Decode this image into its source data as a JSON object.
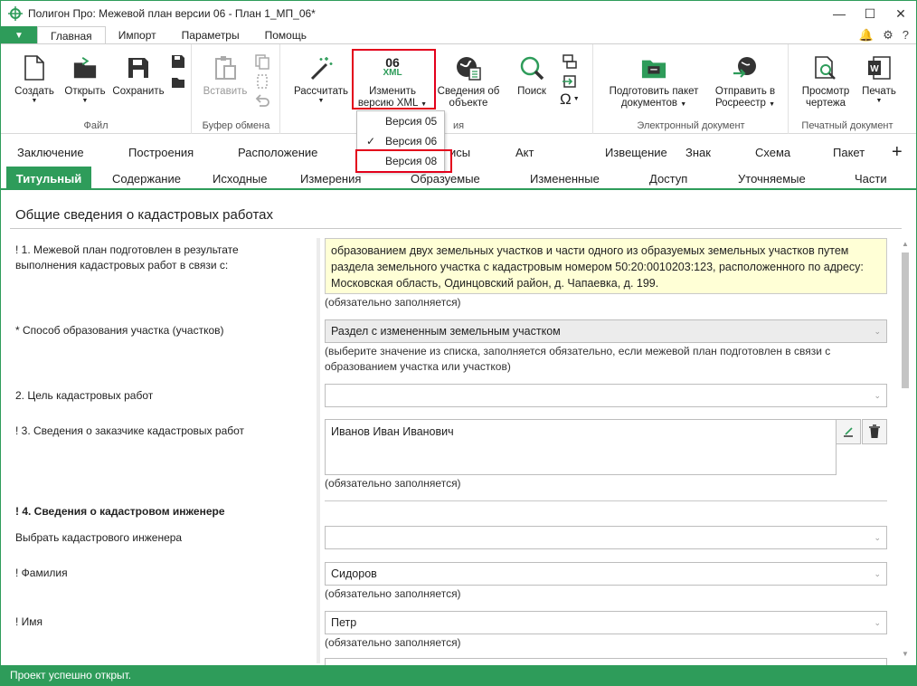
{
  "window": {
    "title": "Полигон Про: Межевой план версии 06 - План 1_МП_06*"
  },
  "menu": {
    "tabs": [
      "Главная",
      "Импорт",
      "Параметры",
      "Помощь"
    ]
  },
  "ribbon": {
    "groups": {
      "file": "Файл",
      "clipboard": "Буфер обмена",
      "edoc": "Электронный документ",
      "print": "Печатный документ",
      "hidden_partial": "ия"
    },
    "buttons": {
      "create": "Создать",
      "open": "Открыть",
      "save": "Сохранить",
      "paste": "Вставить",
      "calculate": "Рассчитать",
      "change_xml_line1": "Изменить",
      "change_xml_line2": "версию XML",
      "xml_version_icon": "06",
      "xml_icon_text": "XML",
      "object_info_line1": "Сведения об",
      "object_info_line2": "объекте",
      "search": "Поиск",
      "omega": "Ω",
      "prepare_line1": "Подготовить пакет",
      "prepare_line2": "документов",
      "send_line1": "Отправить в",
      "send_line2": "Росреестр",
      "preview_line1": "Просмотр",
      "preview_line2": "чертежа",
      "print": "Печать"
    }
  },
  "version_dropdown": {
    "items": [
      "Версия 05",
      "Версия 06",
      "Версия 08"
    ],
    "checked": "Версия 06"
  },
  "tabs_row1": [
    "Заключение",
    "Построения",
    "Расположение",
    "исы",
    "Акт",
    "Извещение",
    "Знак",
    "Схема",
    "Пакет"
  ],
  "tabs_row2": [
    "Титульный",
    "Содержание",
    "Исходные",
    "Измерения",
    "Образуемые",
    "Измененные",
    "Доступ",
    "Уточняемые",
    "Части"
  ],
  "add_tab": "+",
  "section_title": "Общие сведения о кадастровых работах",
  "form": {
    "q1_label_line1": "! 1. Межевой план подготовлен в результате",
    "q1_label_line2": "выполнения кадастровых работ в связи с:",
    "q1_value": "образованием двух земельных участков и части одного из образуемых земельных участков путем раздела земельного участка с кадастровым номером 50:20:0010203:123, расположенного по адресу: Московская область, Одинцовский район, д. Чапаевка, д. 199.",
    "q1_hint": "(обязательно заполняется)",
    "method_label": "* Способ образования участка (участков)",
    "method_value": "Раздел с измененным земельным участком",
    "method_hint_line1": "(выберите значение из списка, заполняется обязательно, если межевой план подготовлен в связи с",
    "method_hint_line2": "образованием участка или участков)",
    "goal_label": "2. Цель кадастровых работ",
    "goal_value": "",
    "customer_label": "! 3. Сведения о заказчике кадастровых работ",
    "customer_value": "Иванов Иван Иванович",
    "customer_hint": "(обязательно заполняется)",
    "engineer_header": "! 4. Сведения о кадастровом инженере",
    "choose_engineer_label": "Выбрать кадастрового инженера",
    "choose_engineer_value": "",
    "surname_label": "! Фамилия",
    "surname_value": "Сидоров",
    "surname_hint": "(обязательно заполняется)",
    "name_label": "! Имя",
    "name_value": "Петр",
    "name_hint": "(обязательно заполняется)"
  },
  "status": "Проект успешно открыт.",
  "colors": {
    "accent": "#2e9c5a",
    "highlight_box": "#e3001b",
    "required_field": "#ffffd6"
  }
}
